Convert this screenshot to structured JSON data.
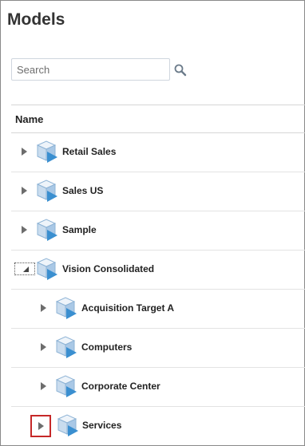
{
  "page": {
    "title": "Models"
  },
  "search": {
    "placeholder": "Search",
    "value": ""
  },
  "table": {
    "name_header": "Name"
  },
  "tree": [
    {
      "label": "Retail Sales",
      "level": 0,
      "state": "collapsed"
    },
    {
      "label": "Sales US",
      "level": 0,
      "state": "collapsed"
    },
    {
      "label": "Sample",
      "level": 0,
      "state": "collapsed"
    },
    {
      "label": "Vision Consolidated",
      "level": 0,
      "state": "expanded"
    },
    {
      "label": "Acquisition Target A",
      "level": 1,
      "state": "collapsed"
    },
    {
      "label": "Computers",
      "level": 1,
      "state": "collapsed"
    },
    {
      "label": "Corporate Center",
      "level": 1,
      "state": "collapsed"
    },
    {
      "label": "Services",
      "level": 1,
      "state": "collapsed",
      "highlighted": true
    }
  ],
  "icons": {
    "search": "search-icon",
    "expand": "expand-arrow-icon",
    "collapse": "collapse-arrow-icon",
    "model": "model-cube-icon"
  },
  "colors": {
    "highlight_border": "#c62828",
    "cube_front": "#3a8fd0",
    "cube_light": "#dce9f5"
  }
}
